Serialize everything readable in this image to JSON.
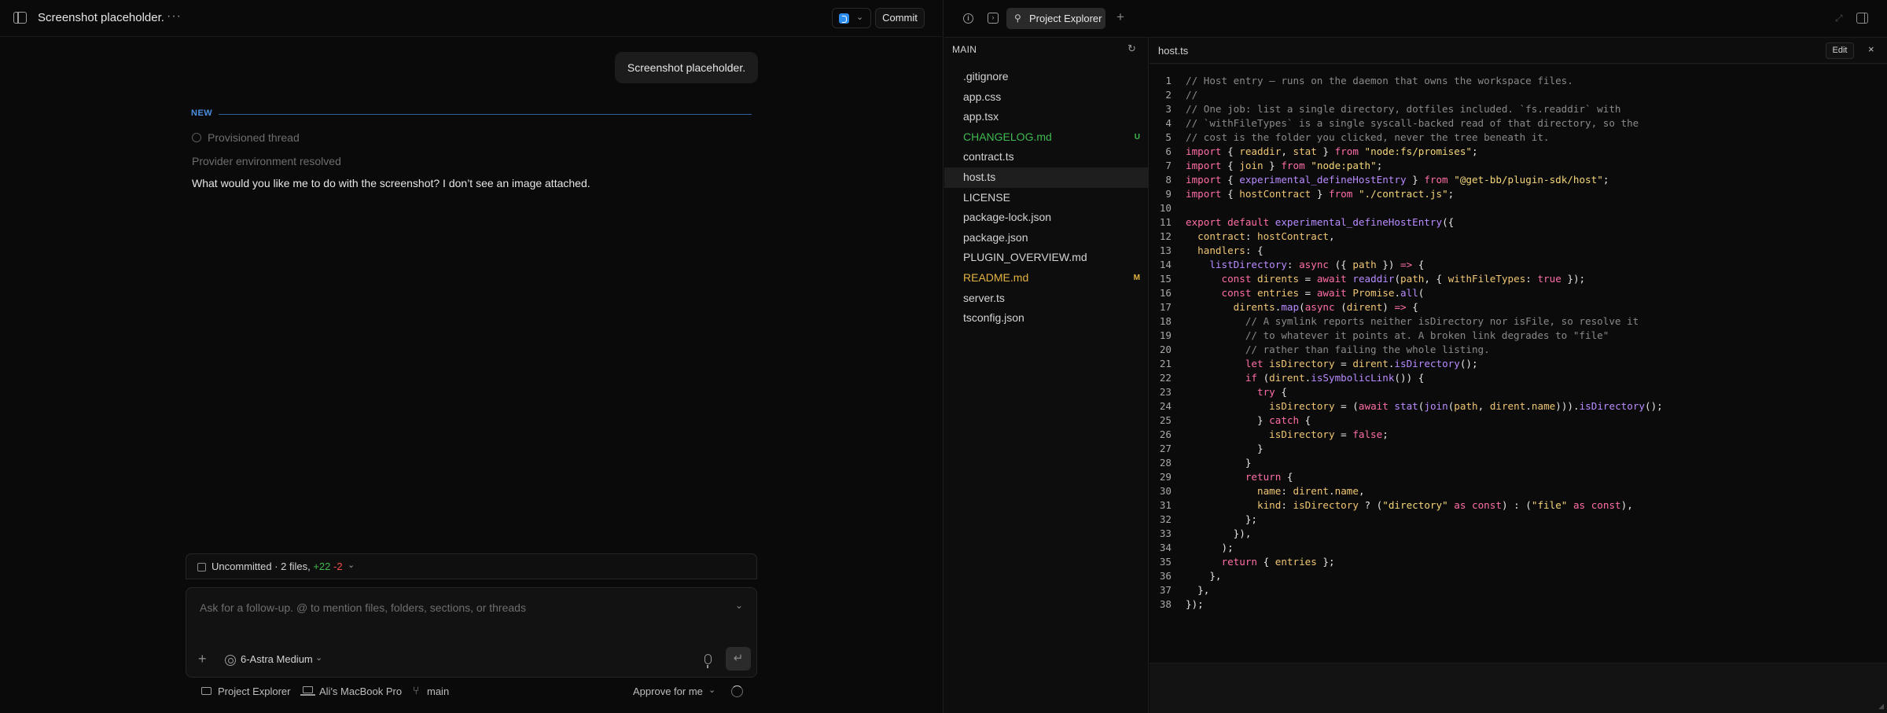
{
  "chat": {
    "title": "Screenshot placeholder.",
    "more_icon": "more-horizontal-icon",
    "commit_label": "Commit",
    "user_message": "Screenshot placeholder.",
    "new_label": "NEW",
    "provisioned_text": "Provisioned thread",
    "provider_text": "Provider environment resolved",
    "assistant_message": "What would you like me to do with the screenshot? I don’t see an image attached.",
    "uncommitted": {
      "prefix": "Uncommitted · 2 files, ",
      "additions": "+22",
      "deletions": "-2"
    },
    "composer": {
      "placeholder": "Ask for a follow-up. @ to mention files, folders, sections, or threads",
      "model_label": "6-Astra Medium"
    },
    "status": {
      "project": "Project Explorer",
      "machine": "Ali's MacBook Pro",
      "branch": "main",
      "approval": "Approve for me"
    }
  },
  "right": {
    "tab_label": "Project Explorer",
    "explorer_header": "MAIN",
    "files": [
      {
        "name": ".gitignore",
        "status": "",
        "badge": ""
      },
      {
        "name": "app.css",
        "status": "",
        "badge": ""
      },
      {
        "name": "app.tsx",
        "status": "",
        "badge": ""
      },
      {
        "name": "CHANGELOG.md",
        "status": "untracked",
        "badge": "U"
      },
      {
        "name": "contract.ts",
        "status": "",
        "badge": ""
      },
      {
        "name": "host.ts",
        "status": "active",
        "badge": ""
      },
      {
        "name": "LICENSE",
        "status": "",
        "badge": ""
      },
      {
        "name": "package-lock.json",
        "status": "",
        "badge": ""
      },
      {
        "name": "package.json",
        "status": "",
        "badge": ""
      },
      {
        "name": "PLUGIN_OVERVIEW.md",
        "status": "",
        "badge": ""
      },
      {
        "name": "README.md",
        "status": "modified",
        "badge": "M"
      },
      {
        "name": "server.ts",
        "status": "",
        "badge": ""
      },
      {
        "name": "tsconfig.json",
        "status": "",
        "badge": ""
      }
    ],
    "editor": {
      "filename": "host.ts",
      "edit_label": "Edit",
      "close_label": "×"
    }
  },
  "colors": {
    "comment": "#8a8a8a",
    "keyword": "#ff6ea8",
    "string": "#f5d77a",
    "function": "#b98cff",
    "property": "#f0c674",
    "text": "#e6e6e6",
    "untracked": "#3fb950",
    "modified": "#e2b340",
    "accent": "#4a8fe0"
  },
  "code": [
    [
      [
        "c",
        "// Host entry — runs on the daemon that owns the workspace files."
      ]
    ],
    [
      [
        "c",
        "//"
      ]
    ],
    [
      [
        "c",
        "// One job: list a single directory, dotfiles included. `fs.readdir` with"
      ]
    ],
    [
      [
        "c",
        "// `withFileTypes` is a single syscall-backed read of that directory, so the"
      ]
    ],
    [
      [
        "c",
        "// cost is the folder you clicked, never the tree beneath it."
      ]
    ],
    [
      [
        "k",
        "import"
      ],
      [
        "t",
        " { "
      ],
      [
        "p",
        "readdir"
      ],
      [
        "t",
        ", "
      ],
      [
        "p",
        "stat"
      ],
      [
        "t",
        " } "
      ],
      [
        "k",
        "from"
      ],
      [
        "t",
        " "
      ],
      [
        "s",
        "\"node:fs/promises\""
      ],
      [
        "t",
        ";"
      ]
    ],
    [
      [
        "k",
        "import"
      ],
      [
        "t",
        " { "
      ],
      [
        "p",
        "join"
      ],
      [
        "t",
        " } "
      ],
      [
        "k",
        "from"
      ],
      [
        "t",
        " "
      ],
      [
        "s",
        "\"node:path\""
      ],
      [
        "t",
        ";"
      ]
    ],
    [
      [
        "k",
        "import"
      ],
      [
        "t",
        " { "
      ],
      [
        "f",
        "experimental_defineHostEntry"
      ],
      [
        "t",
        " } "
      ],
      [
        "k",
        "from"
      ],
      [
        "t",
        " "
      ],
      [
        "s",
        "\"@get-bb/plugin-sdk/host\""
      ],
      [
        "t",
        ";"
      ]
    ],
    [
      [
        "k",
        "import"
      ],
      [
        "t",
        " { "
      ],
      [
        "p",
        "hostContract"
      ],
      [
        "t",
        " } "
      ],
      [
        "k",
        "from"
      ],
      [
        "t",
        " "
      ],
      [
        "s",
        "\"./contract.js\""
      ],
      [
        "t",
        ";"
      ]
    ],
    [
      [
        "t",
        ""
      ]
    ],
    [
      [
        "k",
        "export default"
      ],
      [
        "t",
        " "
      ],
      [
        "f",
        "experimental_defineHostEntry"
      ],
      [
        "t",
        "({"
      ]
    ],
    [
      [
        "t",
        "  "
      ],
      [
        "p",
        "contract"
      ],
      [
        "t",
        ": "
      ],
      [
        "p",
        "hostContract"
      ],
      [
        "t",
        ","
      ]
    ],
    [
      [
        "t",
        "  "
      ],
      [
        "p",
        "handlers"
      ],
      [
        "t",
        ": {"
      ]
    ],
    [
      [
        "t",
        "    "
      ],
      [
        "f",
        "listDirectory"
      ],
      [
        "t",
        ": "
      ],
      [
        "k",
        "async"
      ],
      [
        "t",
        " ({ "
      ],
      [
        "p",
        "path"
      ],
      [
        "t",
        " }) "
      ],
      [
        "k",
        "=>"
      ],
      [
        "t",
        " {"
      ]
    ],
    [
      [
        "t",
        "      "
      ],
      [
        "k",
        "const"
      ],
      [
        "t",
        " "
      ],
      [
        "p",
        "dirents"
      ],
      [
        "t",
        " = "
      ],
      [
        "k",
        "await"
      ],
      [
        "t",
        " "
      ],
      [
        "f",
        "readdir"
      ],
      [
        "t",
        "("
      ],
      [
        "p",
        "path"
      ],
      [
        "t",
        ", { "
      ],
      [
        "p",
        "withFileTypes"
      ],
      [
        "t",
        ": "
      ],
      [
        "k",
        "true"
      ],
      [
        "t",
        " });"
      ]
    ],
    [
      [
        "t",
        "      "
      ],
      [
        "k",
        "const"
      ],
      [
        "t",
        " "
      ],
      [
        "p",
        "entries"
      ],
      [
        "t",
        " = "
      ],
      [
        "k",
        "await"
      ],
      [
        "t",
        " "
      ],
      [
        "p",
        "Promise"
      ],
      [
        "t",
        "."
      ],
      [
        "f",
        "all"
      ],
      [
        "t",
        "("
      ]
    ],
    [
      [
        "t",
        "        "
      ],
      [
        "p",
        "dirents"
      ],
      [
        "t",
        "."
      ],
      [
        "f",
        "map"
      ],
      [
        "t",
        "("
      ],
      [
        "k",
        "async"
      ],
      [
        "t",
        " ("
      ],
      [
        "p",
        "dirent"
      ],
      [
        "t",
        ") "
      ],
      [
        "k",
        "=>"
      ],
      [
        "t",
        " {"
      ]
    ],
    [
      [
        "t",
        "          "
      ],
      [
        "c",
        "// A symlink reports neither isDirectory nor isFile, so resolve it"
      ]
    ],
    [
      [
        "t",
        "          "
      ],
      [
        "c",
        "// to whatever it points at. A broken link degrades to \"file\""
      ]
    ],
    [
      [
        "t",
        "          "
      ],
      [
        "c",
        "// rather than failing the whole listing."
      ]
    ],
    [
      [
        "t",
        "          "
      ],
      [
        "k",
        "let"
      ],
      [
        "t",
        " "
      ],
      [
        "p",
        "isDirectory"
      ],
      [
        "t",
        " = "
      ],
      [
        "p",
        "dirent"
      ],
      [
        "t",
        "."
      ],
      [
        "f",
        "isDirectory"
      ],
      [
        "t",
        "();"
      ]
    ],
    [
      [
        "t",
        "          "
      ],
      [
        "k",
        "if"
      ],
      [
        "t",
        " ("
      ],
      [
        "p",
        "dirent"
      ],
      [
        "t",
        "."
      ],
      [
        "f",
        "isSymbolicLink"
      ],
      [
        "t",
        "()) {"
      ]
    ],
    [
      [
        "t",
        "            "
      ],
      [
        "k",
        "try"
      ],
      [
        "t",
        " {"
      ]
    ],
    [
      [
        "t",
        "              "
      ],
      [
        "p",
        "isDirectory"
      ],
      [
        "t",
        " = ("
      ],
      [
        "k",
        "await"
      ],
      [
        "t",
        " "
      ],
      [
        "f",
        "stat"
      ],
      [
        "t",
        "("
      ],
      [
        "f",
        "join"
      ],
      [
        "t",
        "("
      ],
      [
        "p",
        "path"
      ],
      [
        "t",
        ", "
      ],
      [
        "p",
        "dirent"
      ],
      [
        "t",
        "."
      ],
      [
        "p",
        "name"
      ],
      [
        "t",
        ")))."
      ],
      [
        "f",
        "isDirectory"
      ],
      [
        "t",
        "();"
      ]
    ],
    [
      [
        "t",
        "            } "
      ],
      [
        "k",
        "catch"
      ],
      [
        "t",
        " {"
      ]
    ],
    [
      [
        "t",
        "              "
      ],
      [
        "p",
        "isDirectory"
      ],
      [
        "t",
        " = "
      ],
      [
        "k",
        "false"
      ],
      [
        "t",
        ";"
      ]
    ],
    [
      [
        "t",
        "            }"
      ]
    ],
    [
      [
        "t",
        "          }"
      ]
    ],
    [
      [
        "t",
        "          "
      ],
      [
        "k",
        "return"
      ],
      [
        "t",
        " {"
      ]
    ],
    [
      [
        "t",
        "            "
      ],
      [
        "p",
        "name"
      ],
      [
        "t",
        ": "
      ],
      [
        "p",
        "dirent"
      ],
      [
        "t",
        "."
      ],
      [
        "p",
        "name"
      ],
      [
        "t",
        ","
      ]
    ],
    [
      [
        "t",
        "            "
      ],
      [
        "p",
        "kind"
      ],
      [
        "t",
        ": "
      ],
      [
        "p",
        "isDirectory"
      ],
      [
        "t",
        " ? ("
      ],
      [
        "s",
        "\"directory\""
      ],
      [
        "t",
        " "
      ],
      [
        "k",
        "as const"
      ],
      [
        "t",
        ") : ("
      ],
      [
        "s",
        "\"file\""
      ],
      [
        "t",
        " "
      ],
      [
        "k",
        "as const"
      ],
      [
        "t",
        "),"
      ]
    ],
    [
      [
        "t",
        "          };"
      ]
    ],
    [
      [
        "t",
        "        }),"
      ]
    ],
    [
      [
        "t",
        "      );"
      ]
    ],
    [
      [
        "t",
        "      "
      ],
      [
        "k",
        "return"
      ],
      [
        "t",
        " { "
      ],
      [
        "p",
        "entries"
      ],
      [
        "t",
        " };"
      ]
    ],
    [
      [
        "t",
        "    },"
      ]
    ],
    [
      [
        "t",
        "  },"
      ]
    ],
    [
      [
        "t",
        "});"
      ]
    ]
  ]
}
